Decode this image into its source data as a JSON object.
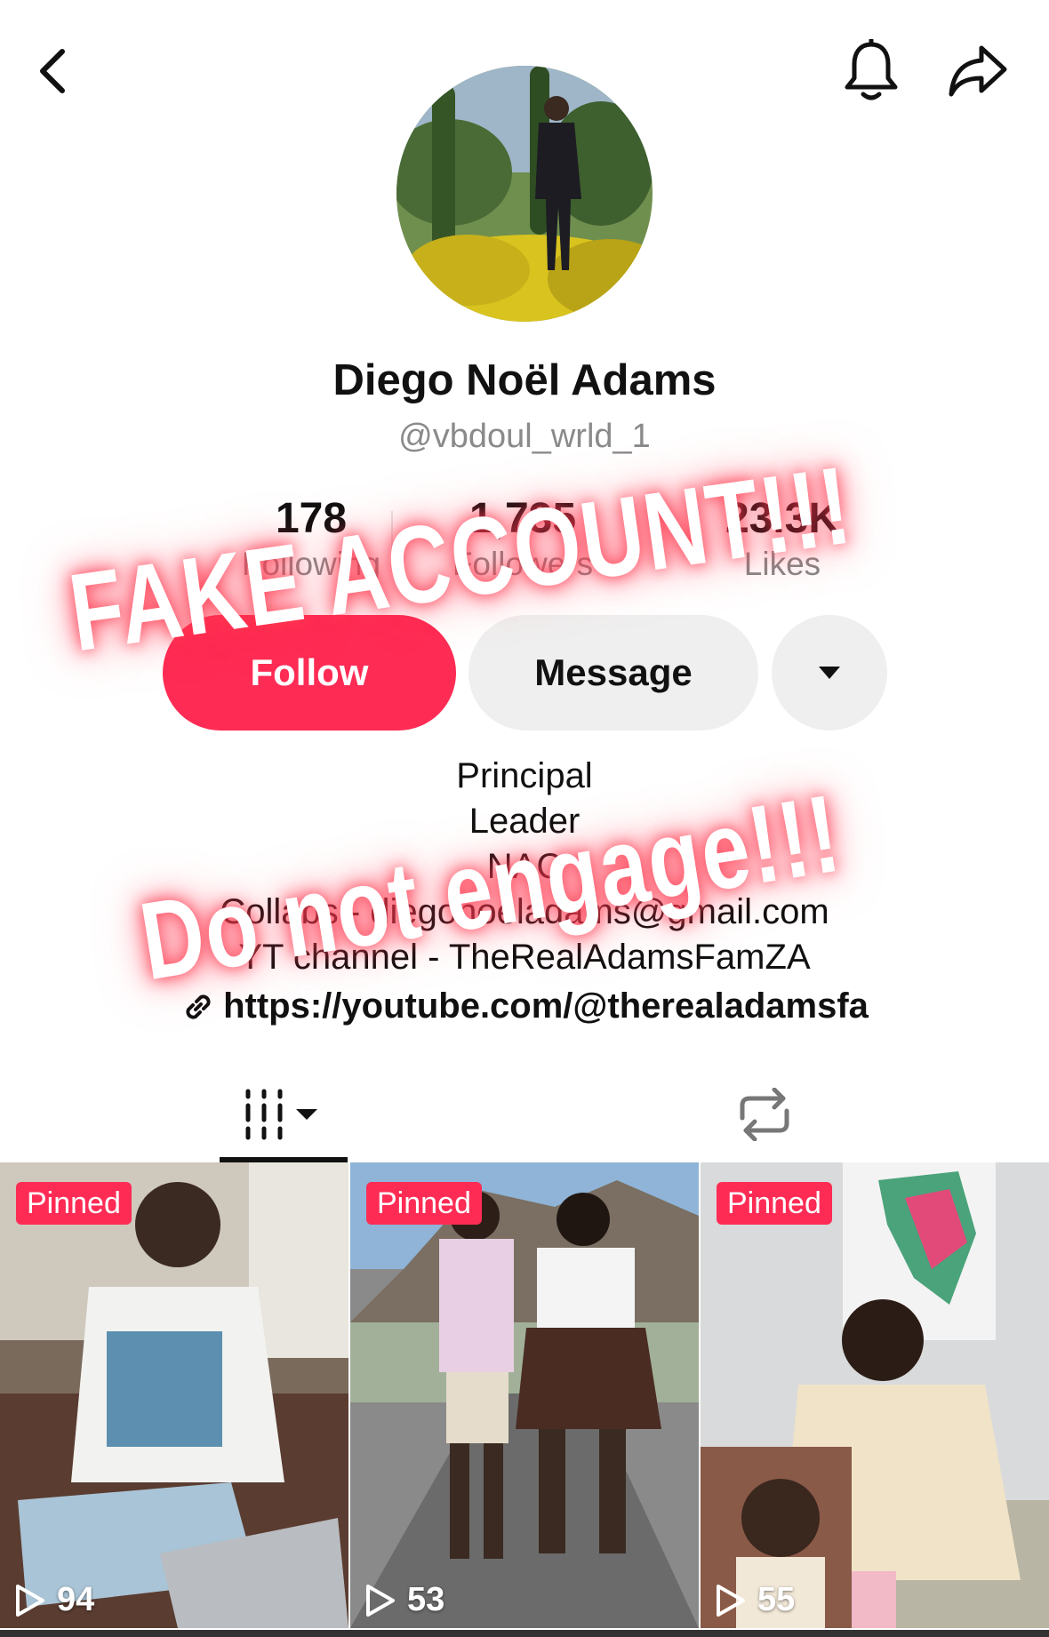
{
  "header": {
    "back_icon": "chevron-left-icon",
    "bell_icon": "bell-icon",
    "share_icon": "share-arrow-icon"
  },
  "profile": {
    "display_name": "Diego Noël Adams",
    "handle": "@vbdoul_wrld_1",
    "avatar_alt": "profile photo"
  },
  "stats": [
    {
      "value": "178",
      "label": "Following"
    },
    {
      "value": "1,735",
      "label": "Followers"
    },
    {
      "value": "23.3K",
      "label": "Likes"
    }
  ],
  "actions": {
    "follow_label": "Follow",
    "message_label": "Message",
    "more_icon": "caret-down-icon"
  },
  "bio": {
    "lines": [
      "Principal",
      "Leader",
      "NAC",
      "Collabs - diegonoeladams@gmail.com",
      "YT channel - TheRealAdamsFamZA"
    ],
    "link": "https://youtube.com/@therealadamsfa",
    "link_icon": "link-icon"
  },
  "tabs": {
    "videos_icon": "videos-grid-icon",
    "reposts_icon": "repost-icon"
  },
  "videos": [
    {
      "badge": "Pinned",
      "views": "94"
    },
    {
      "badge": "Pinned",
      "views": "53"
    },
    {
      "badge": "Pinned",
      "views": "55"
    }
  ],
  "overlay": {
    "line1": "FAKE ACCOUNT!!!",
    "line2": "Do not engage!!!"
  },
  "colors": {
    "accent": "#fe2c55",
    "secondary_button": "#efefef",
    "muted_text": "#8a8a8a"
  }
}
